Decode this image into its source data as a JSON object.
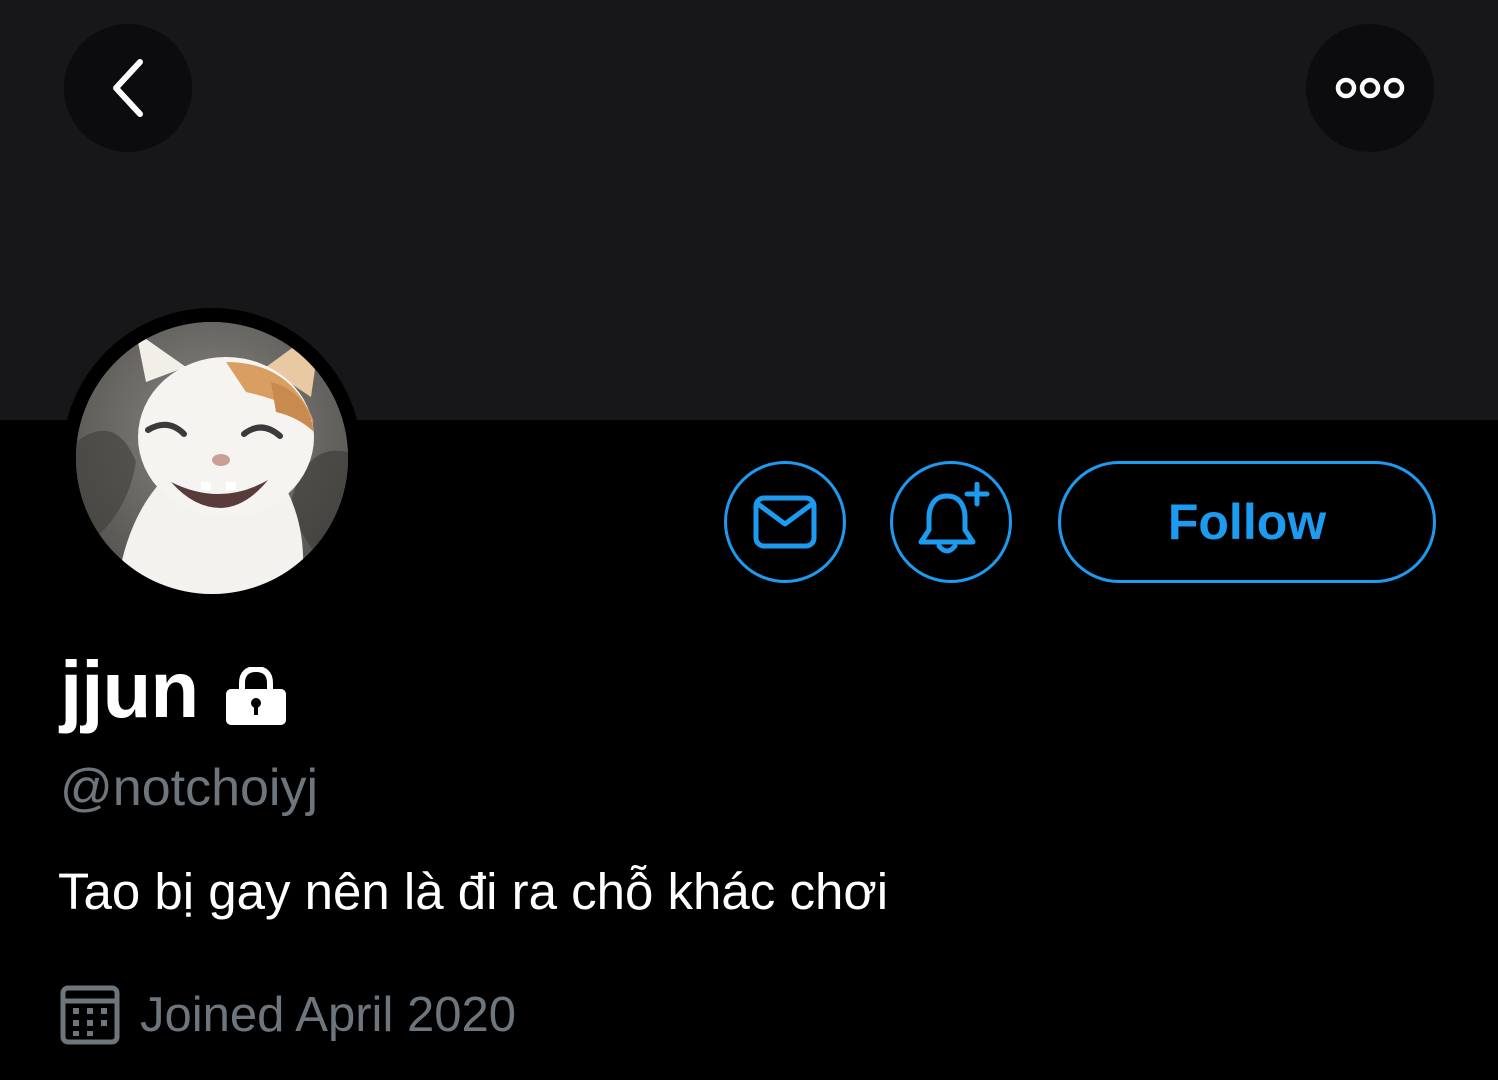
{
  "header": {
    "back_icon": "chevron-left-icon",
    "more_icon": "more-horizontal-icon"
  },
  "profile": {
    "display_name": "jjun",
    "protected_icon": "lock-icon",
    "handle": "@notchoiyj",
    "bio": "Tao bị gay nên là đi ra chỗ khác chơi",
    "joined": "Joined April 2020",
    "joined_icon": "calendar-icon",
    "avatar": "cat-avatar"
  },
  "actions": {
    "message_icon": "envelope-icon",
    "notify_icon": "bell-plus-icon",
    "follow_label": "Follow"
  },
  "colors": {
    "accent": "#1d9bf0",
    "banner": "#17171a",
    "background": "#000000",
    "secondary_text": "#6e767d",
    "primary_text": "#ffffff"
  }
}
